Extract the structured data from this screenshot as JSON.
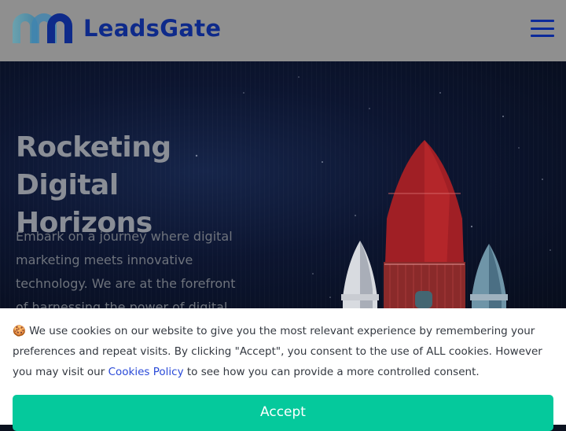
{
  "header": {
    "brand": "LeadsGate",
    "logo_icon": "leadsgate-logo-icon",
    "menu_icon": "hamburger-menu-icon"
  },
  "hero": {
    "title_line1": "Rocketing Digital",
    "title_line2": "Horizons",
    "description": "Embark on a journey where digital marketing meets innovative technology. We are at the forefront of harnessing the power of digital"
  },
  "cookie_banner": {
    "icon": "🍪",
    "text_before_link": " We use cookies on our website to give you the most relevant experience by remembering your preferences and repeat visits. By clicking \"Accept\", you consent to the use of ALL cookies. However you may visit our ",
    "link_label": "Cookies Policy",
    "text_after_link": " to see how you can provide a more controlled consent.",
    "accept_label": "Accept"
  },
  "colors": {
    "brand_blue": "#0e2a8a",
    "accept_green": "#05c99c",
    "link_blue": "#2a4ad8"
  }
}
